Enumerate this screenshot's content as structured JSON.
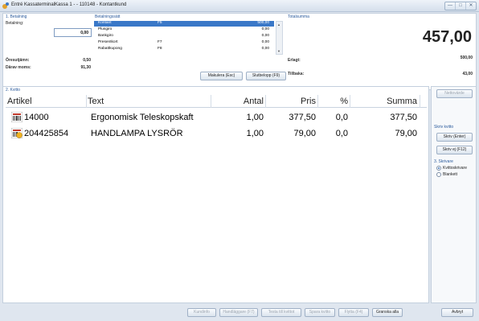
{
  "window": {
    "title": "Entré KassaterminalKassa 1 -  - 110148 - Kontantkund",
    "controls": [
      "—",
      "□",
      "✕"
    ]
  },
  "betalning": {
    "section_label": "1. Betalning",
    "amount_label": "Betalning:",
    "amount_value": "0,00",
    "rounding_label": "Öresutjämn:",
    "rounding_value": "0,50",
    "vat_label": "Därav moms:",
    "vat_value": "91,30"
  },
  "methods": {
    "section_label": "Betalningssätt",
    "items": [
      {
        "name": "Kontant",
        "key": "F5",
        "amount": "500,00",
        "selected": true
      },
      {
        "name": "Plusgiro",
        "key": "",
        "amount": "0,00",
        "selected": false
      },
      {
        "name": "Bankgiro",
        "key": "",
        "amount": "0,00",
        "selected": false
      },
      {
        "name": "Presentkort",
        "key": "F7",
        "amount": "0,00",
        "selected": false
      },
      {
        "name": "Rabattkupong",
        "key": "F8",
        "amount": "0,00",
        "selected": false
      }
    ],
    "cancel_button": "Makulera (Esc)",
    "final_button": "Slutbelopp (F9)"
  },
  "totals": {
    "section_label": "Totalsumma",
    "total": "457,00",
    "paid_label": "Erlagt:",
    "paid_value": "500,00",
    "change_label": "Tillbaka:",
    "change_value": "43,00"
  },
  "receipt": {
    "section_label": "2. Kvitto",
    "columns": [
      "Artikel",
      "Text",
      "Antal",
      "Pris",
      "%",
      "Summa"
    ],
    "rows": [
      {
        "artikel": "14000",
        "text": "Ergonomisk Teleskopskaft",
        "antal": "1,00",
        "pris": "377,50",
        "rabatt": "0,0",
        "summa": "377,50"
      },
      {
        "artikel": "204425854",
        "text": "HANDLAMPA LYSRÖR",
        "antal": "1,00",
        "pris": "79,00",
        "rabatt": "0,0",
        "summa": "79,00"
      }
    ]
  },
  "sidebar": {
    "nettovarde_button": "Nettovärde",
    "print_label": "Skriv kvitto",
    "print_button": "Skriv (Enter)",
    "noprint_button": "Skriv ej (F12)",
    "printer_label": "3. Skrivare",
    "printers": [
      {
        "label": "Kvittoskrivare",
        "selected": true
      },
      {
        "label": "Blankett",
        "selected": false
      }
    ]
  },
  "footer": {
    "buttons": [
      {
        "label": "Kundinfo",
        "enabled": false
      },
      {
        "label": "Handläggare (F7)",
        "enabled": false
      },
      {
        "label": "Testa till kvittot",
        "enabled": false
      },
      {
        "label": "Spara kvitto",
        "enabled": false
      },
      {
        "label": "Flytta (F4)",
        "enabled": false
      },
      {
        "label": "Granska alla",
        "enabled": true
      },
      {
        "label": "Avbryt",
        "enabled": true
      }
    ]
  }
}
